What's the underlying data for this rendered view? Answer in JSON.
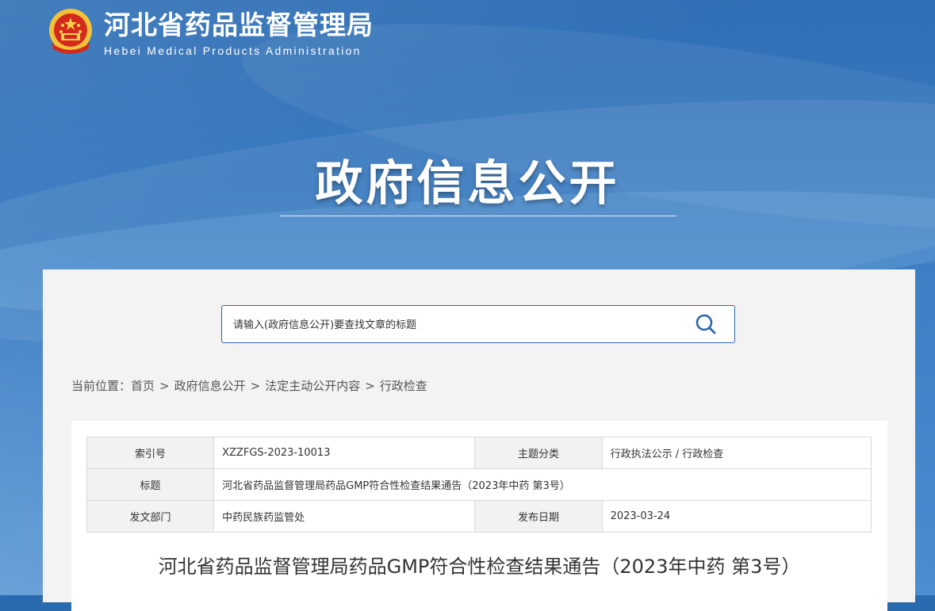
{
  "header": {
    "site_name_cn": "河北省药品监督管理局",
    "site_name_en": "Hebei Medical Products Administration",
    "emblem_icon": "national-emblem-icon"
  },
  "hero": {
    "title": "政府信息公开"
  },
  "search": {
    "placeholder": "请输入(政府信息公开)要查找文章的标题",
    "icon": "search-icon"
  },
  "breadcrumb": {
    "prefix": "当前位置：",
    "items": [
      "首页",
      "政府信息公开",
      "法定主动公开内容",
      "行政检查"
    ],
    "separator": ">"
  },
  "info_table": {
    "row1": {
      "label1": "索引号",
      "value1": "XZZFGS-2023-10013",
      "label2": "主题分类",
      "value2": "行政执法公示 / 行政检查"
    },
    "row2": {
      "label1": "标题",
      "value1": "河北省药品监督管理局药品GMP符合性检查结果通告（2023年中药 第3号）"
    },
    "row3": {
      "label1": "发文部门",
      "value1": "中药民族药监管处",
      "label2": "发布日期",
      "value2": "2023-03-24"
    }
  },
  "article": {
    "title": "河北省药品监督管理局药品GMP符合性检查结果通告（2023年中药 第3号）"
  },
  "colors": {
    "banner": "#2f6fb5",
    "accent": "#2e64a8",
    "panel": "#f3f3f3"
  }
}
